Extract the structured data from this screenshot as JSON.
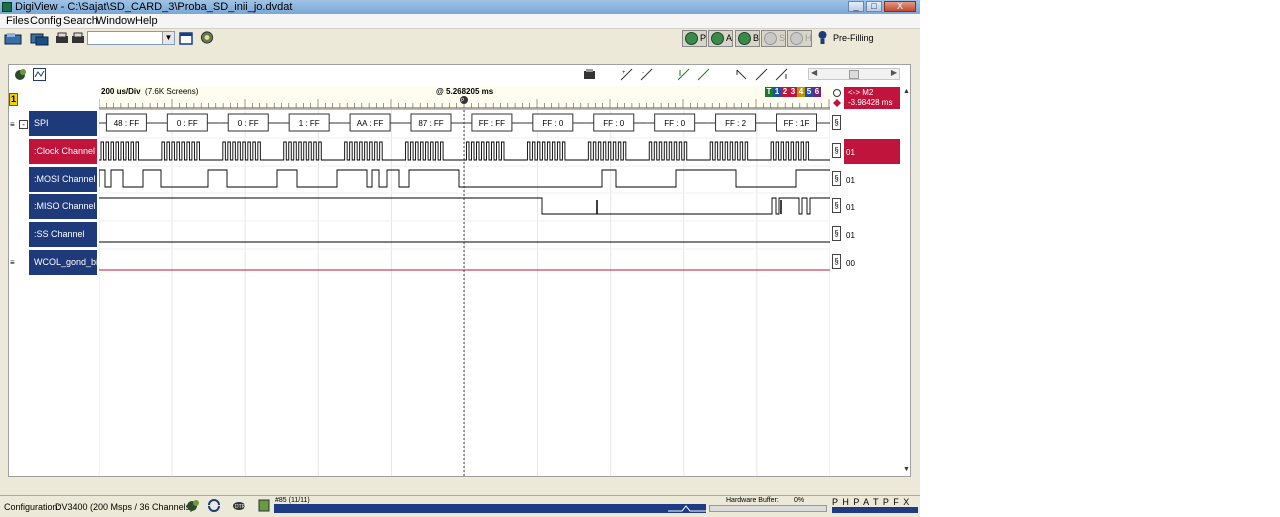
{
  "window": {
    "title": "DigiView - C:\\Sajat\\SD_CARD_3\\Proba_SD_inii_jo.dvdat",
    "min_label": "_",
    "max_label": "□",
    "close_label": "X"
  },
  "menu": [
    "Files",
    "Config",
    "Search",
    "Window",
    "Help"
  ],
  "toolbar": {
    "run_buttons": [
      {
        "label": "P",
        "enabled": true
      },
      {
        "label": "A",
        "enabled": true
      },
      {
        "label": "B",
        "enabled": true
      },
      {
        "label": "S",
        "enabled": false
      },
      {
        "label": "H",
        "enabled": false
      }
    ],
    "prefill_label": "Pre-Filling"
  },
  "timeline": {
    "scale_label": "200 us/Div",
    "screens_label": "(7.6K Screens)",
    "cursor_time": "@ 5.268205 ms",
    "marker_chips": [
      "T",
      "1",
      "2",
      "3",
      "4",
      "5",
      "6"
    ],
    "m2_label": "<-> M2",
    "m2_value": "-3.98428 ms",
    "screen_badge": "1"
  },
  "channels": {
    "spi_group": {
      "label": "SPI",
      "packets": [
        "48 : FF",
        "0 : FF",
        "0 : FF",
        "1 : FF",
        "AA : FF",
        "87 : FF",
        "FF : FF",
        "FF : 0",
        "FF : 0",
        "FF : 0",
        "FF : 2",
        "FF : 1F"
      ]
    },
    "list": [
      {
        "label": ":Clock Channel",
        "value": "01",
        "selected": true
      },
      {
        "label": ":MOSI Channel",
        "value": "01",
        "selected": false
      },
      {
        "label": ":MISO Channel",
        "value": "01",
        "selected": false
      },
      {
        "label": ":SS Channel",
        "value": "01",
        "selected": false
      },
      {
        "label": "WCOL_gond_bit",
        "value": "00",
        "selected": false
      }
    ]
  },
  "status": {
    "config_label": "Configuration:",
    "config_value": "DV3400 (200 Msps / 36 Channels)",
    "progress_label": "#85 (11/11)",
    "hw_buffer_label": "Hardware Buffer:",
    "hw_buffer_pct": "0%",
    "flags": "P H   P A T   P F X"
  },
  "colors": {
    "channel_bg": "#1f3a7a",
    "selected": "#c0143c",
    "chip_colors": [
      "#1a7a2a",
      "#1f4ea8",
      "#c0143c",
      "#c0143c",
      "#b89a00",
      "#1f4ea8",
      "#7a1f7a"
    ]
  }
}
